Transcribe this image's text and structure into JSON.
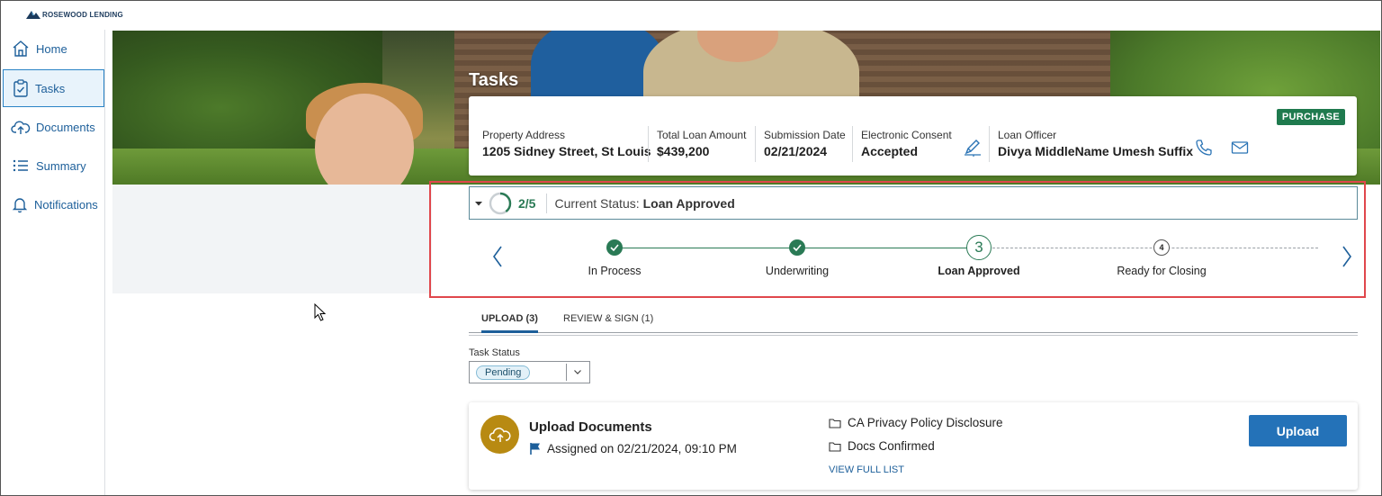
{
  "brand": {
    "name": "ROSEWOOD LENDING"
  },
  "sidebar": {
    "items": [
      {
        "label": "Home",
        "icon": "home-icon"
      },
      {
        "label": "Tasks",
        "icon": "tasks-icon",
        "active": true
      },
      {
        "label": "Documents",
        "icon": "cloud-documents-icon"
      },
      {
        "label": "Summary",
        "icon": "list-icon"
      },
      {
        "label": "Notifications",
        "icon": "bell-icon"
      }
    ]
  },
  "page": {
    "title": "Tasks"
  },
  "loan": {
    "badge": "PURCHASE",
    "property_address_label": "Property Address",
    "property_address": "1205 Sidney Street, St Louis",
    "total_loan_label": "Total Loan Amount",
    "total_loan": "$439,200",
    "submission_date_label": "Submission Date",
    "submission_date": "02/21/2024",
    "consent_label": "Electronic Consent",
    "consent_value": "Accepted",
    "officer_label": "Loan Officer",
    "officer_name": "Divya MiddleName Umesh Suffix"
  },
  "status": {
    "progress": "2/5",
    "progress_fraction": 0.4,
    "current_label": "Current Status:",
    "current_value": "Loan Approved",
    "steps": [
      {
        "label": "In Process",
        "state": "done"
      },
      {
        "label": "Underwriting",
        "state": "done"
      },
      {
        "label": "Loan Approved",
        "state": "current",
        "number": "3"
      },
      {
        "label": "Ready for Closing",
        "state": "todo",
        "number": "4"
      }
    ]
  },
  "tabs": [
    {
      "label": "UPLOAD (3)",
      "active": true
    },
    {
      "label": "REVIEW & SIGN (1)",
      "active": false
    }
  ],
  "task_filter": {
    "label": "Task Status",
    "value": "Pending"
  },
  "task": {
    "title": "Upload Documents",
    "assigned": "Assigned on 02/21/2024, 09:10 PM",
    "documents": [
      "CA Privacy Policy Disclosure",
      "Docs Confirmed"
    ],
    "view_full": "VIEW FULL LIST",
    "button": "Upload"
  },
  "colors": {
    "accent": "#2472b8",
    "success": "#2a7a55",
    "badge": "#1f7a4e",
    "highlight_box": "#e0474c",
    "task_icon": "#b88a12"
  }
}
